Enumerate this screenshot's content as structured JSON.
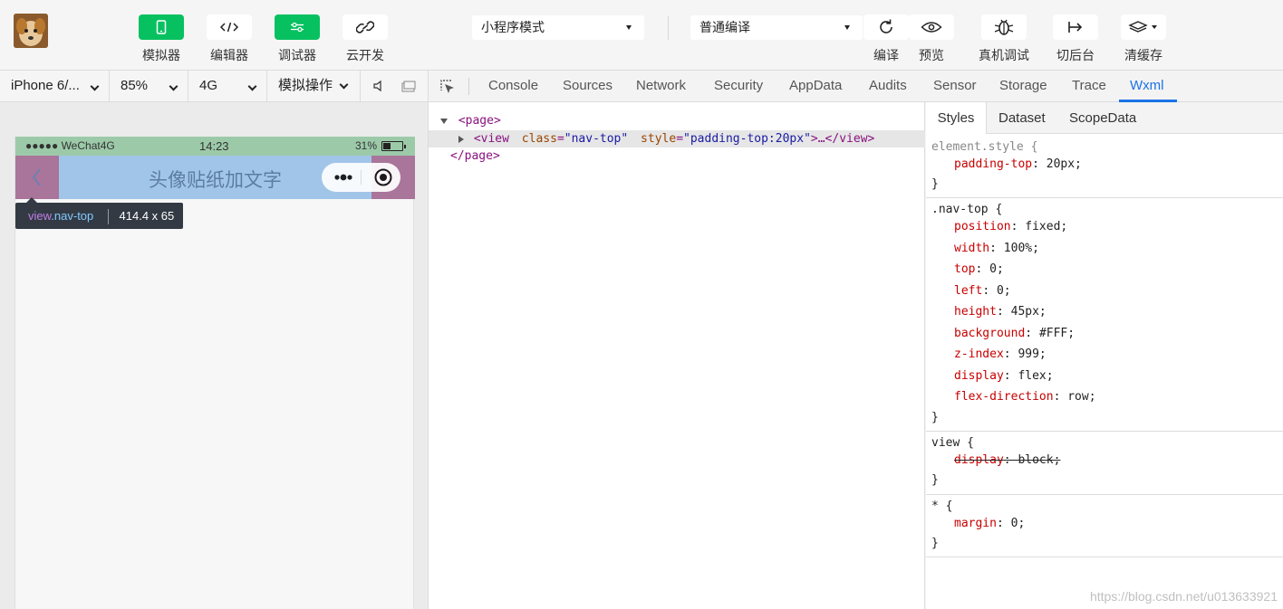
{
  "toolbar": {
    "tools": [
      {
        "label": "模拟器",
        "icon": "phone-icon"
      },
      {
        "label": "编辑器",
        "icon": "code-icon"
      },
      {
        "label": "调试器",
        "icon": "sliders-icon"
      },
      {
        "label": "云开发",
        "icon": "cloud-link-icon"
      }
    ],
    "mode_select": "小程序模式",
    "compile_select": "普通编译",
    "actions": [
      {
        "label": "编译",
        "icon": "refresh-icon"
      },
      {
        "label": "预览",
        "icon": "eye-icon"
      },
      {
        "label": "真机调试",
        "icon": "bug-icon"
      },
      {
        "label": "切后台",
        "icon": "exit-icon"
      },
      {
        "label": "清缓存",
        "icon": "layers-icon"
      }
    ]
  },
  "device_bar": {
    "device": "iPhone 6/...",
    "zoom": "85%",
    "network": "4G",
    "ops": "模拟操作"
  },
  "simulator": {
    "status_carrier": "●●●●● WeChat4G",
    "status_time": "14:23",
    "status_battery": "31%",
    "nav_title": "头像贴纸加文字",
    "tooltip_selector_tag": "view",
    "tooltip_selector_class": ".nav-top",
    "tooltip_size": "414.4 x 65"
  },
  "devtools": {
    "tabs": [
      "Console",
      "Sources",
      "Network",
      "Security",
      "AppData",
      "Audits",
      "Sensor",
      "Storage",
      "Trace",
      "Wxml"
    ],
    "active_tab": "Wxml",
    "tree": {
      "page_open": "<page>",
      "view_open_tag": "<view",
      "attr_class_name": "class",
      "attr_class_value": "\"nav-top\"",
      "attr_style_name": "style",
      "attr_style_value": "\"padding-top:20px\"",
      "view_close": ">…</view>",
      "page_close": "</page>"
    }
  },
  "styles": {
    "tabs": [
      "Styles",
      "Dataset",
      "ScopeData"
    ],
    "active_tab": "Styles",
    "rules": [
      {
        "selector": "element.style {",
        "props": [
          {
            "name": "padding-top",
            "value": "20px;"
          }
        ]
      },
      {
        "selector": ".nav-top {",
        "props": [
          {
            "name": "position",
            "value": "fixed;"
          },
          {
            "name": "width",
            "value": "100%;"
          },
          {
            "name": "top",
            "value": "0;"
          },
          {
            "name": "left",
            "value": "0;"
          },
          {
            "name": "height",
            "value": "45px;"
          },
          {
            "name": "background",
            "value": "#FFF;"
          },
          {
            "name": "z-index",
            "value": "999;"
          },
          {
            "name": "display",
            "value": "flex;"
          },
          {
            "name": "flex-direction",
            "value": "row;"
          }
        ]
      },
      {
        "selector": "view {",
        "props": [
          {
            "name": "display",
            "value": "block;",
            "struck": true
          }
        ]
      },
      {
        "selector": "* {",
        "props": [
          {
            "name": "margin",
            "value": "0;"
          }
        ]
      }
    ],
    "close_brace": "}"
  },
  "watermark": "https://blog.csdn.net/u013633921",
  "colors": {
    "accent_green": "#07c160",
    "active_tab_blue": "#1a73e8",
    "nav_highlight": "#a1c5e8",
    "padding_highlight": "#a9759b",
    "status_bar": "#9ccaa9"
  }
}
